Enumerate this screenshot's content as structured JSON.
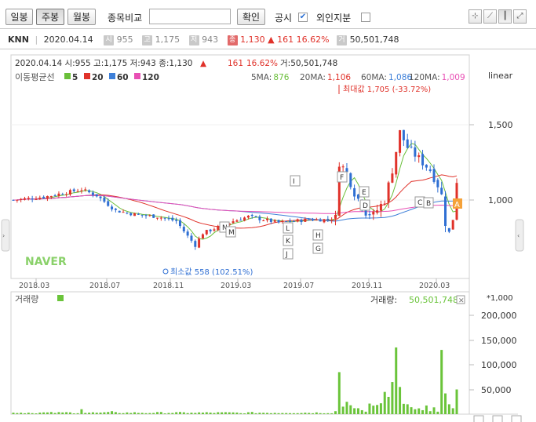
{
  "toolbar": {
    "tabs": [
      {
        "label": "일봉",
        "active": false
      },
      {
        "label": "주봉",
        "active": true
      },
      {
        "label": "월봉",
        "active": false
      }
    ],
    "compare_label": "종목비교",
    "compare_value": "",
    "confirm_label": "확인",
    "disclosure_label": "공시",
    "disclosure_checked": true,
    "foreign_label": "외인지분",
    "foreign_checked": false
  },
  "info_bar": {
    "ticker": "KNN",
    "date": "2020.04.14",
    "open_icon": "시",
    "open": "955",
    "high_icon": "고",
    "high": "1,175",
    "low_icon": "저",
    "low": "943",
    "close_icon": "종",
    "close": "1,130",
    "change_arrow": "▲",
    "change": "161",
    "change_pct": "16.62%",
    "volume_icon": "거",
    "volume": "50,501,748"
  },
  "chart_header": {
    "text_prefix": "2020.04.14 시:955 고:1,175 저:943 종:1,130",
    "arrow": "▲",
    "change": "161",
    "change_pct": "16.62%",
    "volume_text": "거:50,501,748"
  },
  "moving_avg": {
    "label": "이동평균선",
    "periods": [
      {
        "label": "5",
        "color": "#6abf3a"
      },
      {
        "label": "20",
        "color": "#e0322a"
      },
      {
        "label": "60",
        "color": "#3d7fd8"
      },
      {
        "label": "120",
        "color": "#e84fb4"
      }
    ],
    "values": [
      {
        "label": "5MA:",
        "value": "876",
        "color": "#6abf3a"
      },
      {
        "label": "20MA:",
        "value": "1,106",
        "color": "#e0322a"
      },
      {
        "label": "60MA:",
        "value": "1,086",
        "color": "#3d7fd8"
      },
      {
        "label": "120MA:",
        "value": "1,009",
        "color": "#e84fb4"
      }
    ]
  },
  "scale_label": "linear",
  "price_axis_labels": [
    "1,500",
    "1,000"
  ],
  "x_axis_labels": [
    "2018.03",
    "2018.07",
    "2018.11",
    "2019.03",
    "2019.07",
    "2019.11",
    "2020.03"
  ],
  "max_annotation": "최대값 1,705 (-33.72%)",
  "min_annotation": "최소값 558 (102.51%)",
  "watermark": "NAVER",
  "event_markers": [
    "I",
    "N",
    "M",
    "L",
    "K",
    "J",
    "H",
    "G",
    "F",
    "E",
    "D",
    "C",
    "B",
    "A"
  ],
  "volume_panel": {
    "label": "거래량",
    "readout_label": "거래량:",
    "readout_value": "50,501,748",
    "unit": "*1,000",
    "axis_labels": [
      "200,000",
      "150,000",
      "100,000",
      "50,000"
    ]
  },
  "colors": {
    "up": "#e0322a",
    "down": "#2f6fd3",
    "volume": "#6ac43a"
  },
  "chart_data": {
    "type": "candlestick",
    "x_range": [
      "2018.01",
      "2020.04"
    ],
    "y_range": [
      500,
      1800
    ],
    "volume_unit": "*1,000",
    "last_candle": {
      "date": "2020.04.14",
      "open": 955,
      "high": 1175,
      "low": 943,
      "close": 1130,
      "volume": 50501748
    },
    "max_price": 1705,
    "min_price": 558,
    "ma_current": {
      "ma5": 876,
      "ma20": 1106,
      "ma60": 1086,
      "ma120": 1009
    }
  }
}
